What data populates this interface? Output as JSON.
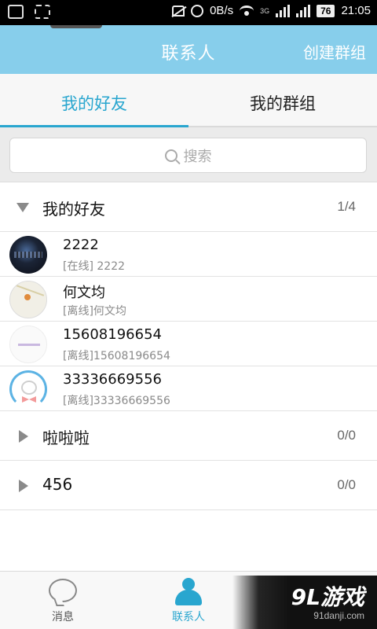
{
  "status_bar": {
    "net_speed": "0B/s",
    "net_type": "3G",
    "battery": "76",
    "time": "21:05"
  },
  "header": {
    "title": "联系人",
    "create_group": "创建群组"
  },
  "tabs": [
    {
      "label": "我的好友",
      "active": true
    },
    {
      "label": "我的群组",
      "active": false
    }
  ],
  "search": {
    "placeholder": "搜索"
  },
  "groups": [
    {
      "name": "我的好友",
      "count": "1/4",
      "expanded": true,
      "contacts": [
        {
          "name": "2222",
          "status": "[在线] 2222"
        },
        {
          "name": "何文均",
          "status": "[离线]何文均"
        },
        {
          "name": "15608196654",
          "status": "[离线]15608196654"
        },
        {
          "name": "33336669556",
          "status": "[离线]33336669556"
        }
      ]
    },
    {
      "name": "啦啦啦",
      "count": "0/0",
      "expanded": false
    },
    {
      "name": "456",
      "count": "0/0",
      "expanded": false
    }
  ],
  "bottom_nav": [
    {
      "label": "消息",
      "icon": "chat-bubble-icon",
      "active": false
    },
    {
      "label": "联系人",
      "icon": "person-icon",
      "active": true
    },
    {
      "label": "",
      "icon": "mail-icon",
      "active": false
    }
  ],
  "watermark": {
    "logo": "9L游戏",
    "url": "91danji.com"
  },
  "colors": {
    "accent": "#29a6cf",
    "header_bg": "#87ceeb"
  }
}
